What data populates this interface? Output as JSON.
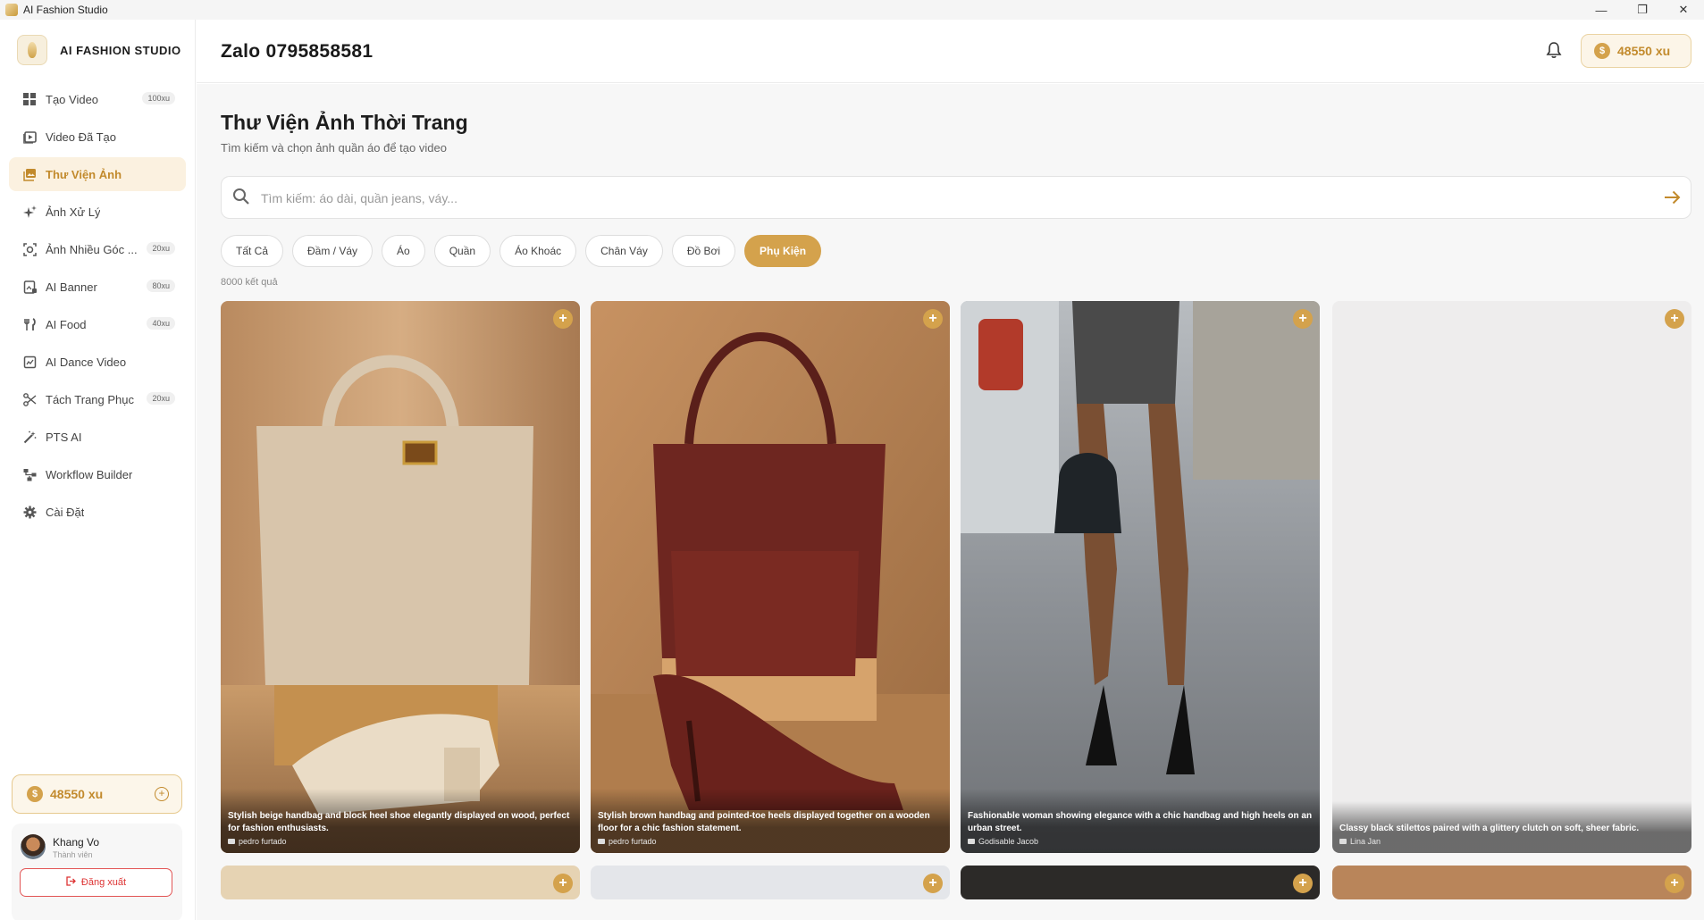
{
  "window": {
    "title": "AI Fashion Studio",
    "min": "—",
    "restore": "❐",
    "close": "✕"
  },
  "brand": {
    "name": "AI FASHION STUDIO"
  },
  "sidebar": {
    "items": [
      {
        "label": "Tạo Video",
        "badge": "100xu",
        "icon": "grid-icon"
      },
      {
        "label": "Video Đã Tạo",
        "badge": "",
        "icon": "video-icon"
      },
      {
        "label": "Thư Viện Ảnh",
        "badge": "",
        "icon": "gallery-icon"
      },
      {
        "label": "Ảnh Xử Lý",
        "badge": "",
        "icon": "sparkle-icon"
      },
      {
        "label": "Ảnh Nhiều Góc ...",
        "badge": "20xu",
        "icon": "camera-focus-icon"
      },
      {
        "label": "AI Banner",
        "badge": "80xu",
        "icon": "banner-icon"
      },
      {
        "label": "AI Food",
        "badge": "40xu",
        "icon": "utensils-icon"
      },
      {
        "label": "AI Dance Video",
        "badge": "",
        "icon": "dance-video-icon"
      },
      {
        "label": "Tách Trang Phục",
        "badge": "20xu",
        "icon": "scissors-icon"
      },
      {
        "label": "PTS AI",
        "badge": "",
        "icon": "magic-wand-icon"
      },
      {
        "label": "Workflow Builder",
        "badge": "",
        "icon": "workflow-icon"
      },
      {
        "label": "Cài Đặt",
        "badge": "",
        "icon": "gear-icon"
      }
    ],
    "credits": "48550 xu",
    "coin_symbol": "$",
    "user": {
      "name": "Khang Vo",
      "role": "Thành viên",
      "logout": "Đăng xuất"
    }
  },
  "header": {
    "title": "Zalo 0795858581",
    "credits": "48550 xu",
    "coin_symbol": "$"
  },
  "main": {
    "title": "Thư Viện Ảnh Thời Trang",
    "subtitle": "Tìm kiếm và chọn ảnh quần áo để tạo video",
    "search": {
      "placeholder": "Tìm kiếm: áo dài, quần jeans, váy...",
      "value": ""
    },
    "filters": [
      {
        "label": "Tất Cả",
        "active": false
      },
      {
        "label": "Đầm / Váy",
        "active": false
      },
      {
        "label": "Áo",
        "active": false
      },
      {
        "label": "Quần",
        "active": false
      },
      {
        "label": "Áo Khoác",
        "active": false
      },
      {
        "label": "Chân Váy",
        "active": false
      },
      {
        "label": "Đồ Bơi",
        "active": false
      },
      {
        "label": "Phụ Kiện",
        "active": true
      }
    ],
    "result_count": "8000 kết quả",
    "add_symbol": "+",
    "cards": [
      {
        "caption": "Stylish beige handbag and block heel shoe elegantly displayed on wood, perfect for fashion enthusiasts.",
        "author": "pedro furtado"
      },
      {
        "caption": "Stylish brown handbag and pointed-toe heels displayed together on a wooden floor for a chic fashion statement.",
        "author": "pedro furtado"
      },
      {
        "caption": "Fashionable woman showing elegance with a chic handbag and high heels on an urban street.",
        "author": "Godisable Jacob"
      },
      {
        "caption": "Classy black stilettos paired with a glittery clutch on soft, sheer fabric.",
        "author": "Lina Jan"
      }
    ]
  },
  "colors": {
    "accent": "#d4a24c",
    "accent_text": "#c28a2c",
    "active_bg": "#fbf1e0",
    "logout": "#e25555"
  }
}
